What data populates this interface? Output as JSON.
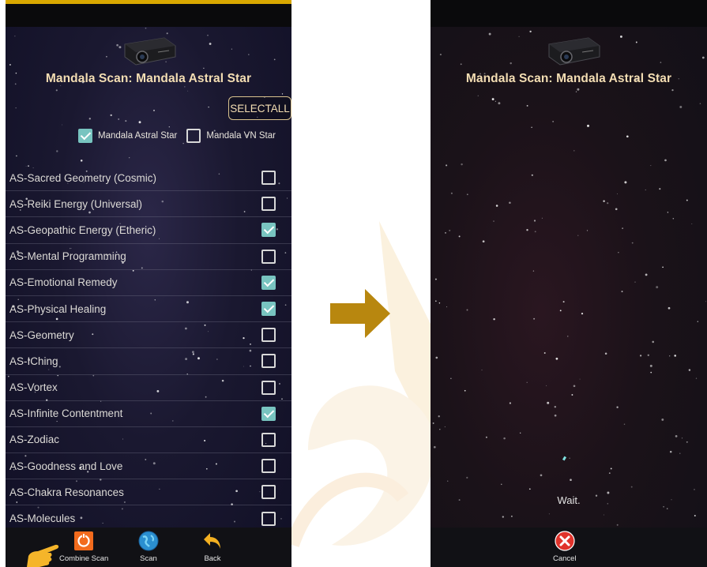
{
  "left_screen": {
    "title": "Mandala Scan: Mandala Astral Star",
    "select_all_label": "SELECTALL",
    "filters": [
      {
        "label": "Mandala Astral Star",
        "checked": true
      },
      {
        "label": "Mandala VN Star",
        "checked": false
      }
    ],
    "items": [
      {
        "label": "AS-Sacred Geometry (Cosmic)",
        "checked": false
      },
      {
        "label": "AS-Reiki Energy (Universal)",
        "checked": false
      },
      {
        "label": "AS-Geopathic Energy (Etheric)",
        "checked": true
      },
      {
        "label": "AS-Mental Programming",
        "checked": false
      },
      {
        "label": "AS-Emotional Remedy",
        "checked": true
      },
      {
        "label": "AS-Physical Healing",
        "checked": true
      },
      {
        "label": "AS-Geometry",
        "checked": false
      },
      {
        "label": "AS-IChing",
        "checked": false
      },
      {
        "label": "AS-Vortex",
        "checked": false
      },
      {
        "label": "AS-Infinite Contentment",
        "checked": true
      },
      {
        "label": "AS-Zodiac",
        "checked": false
      },
      {
        "label": "AS-Goodness and Love",
        "checked": false
      },
      {
        "label": "AS-Chakra Resonances",
        "checked": false
      },
      {
        "label": "AS-Molecules",
        "checked": false
      }
    ],
    "nav": {
      "combine_scan_label": "Combine Scan",
      "scan_label": "Scan",
      "back_label": "Back"
    }
  },
  "right_screen": {
    "title": "Mandala Scan: Mandala Astral Star",
    "status_text": "Wait.",
    "cancel_label": "Cancel"
  },
  "colors": {
    "accent_gold": "#d9a800",
    "title_text": "#f4deb3",
    "checkbox_checked": "#78c4c0",
    "arrow": "#b8870f",
    "cancel_red": "#e0332b"
  },
  "icons": {
    "combine": "combine-scan-icon",
    "scan": "globe-icon",
    "back": "back-arrow-icon",
    "cancel": "cancel-icon",
    "pointer": "pointing-hand-icon",
    "transition": "right-arrow-icon",
    "device": "projector-icon"
  }
}
